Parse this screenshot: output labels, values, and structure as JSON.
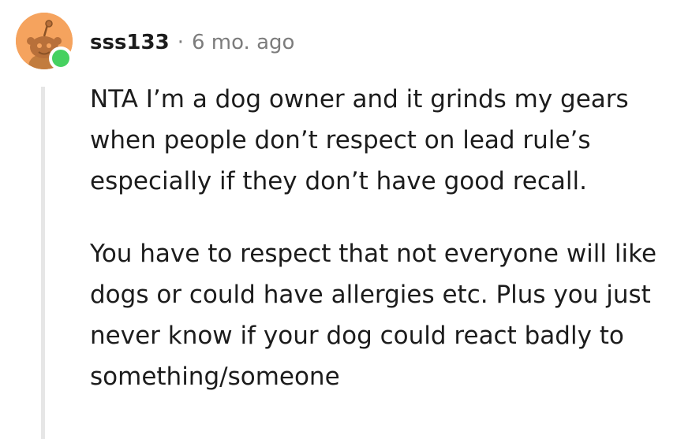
{
  "comment": {
    "author": "sss133",
    "separator": "·",
    "timestamp": "6 mo. ago",
    "avatar_icon": "reddit-snoo-avatar-icon",
    "online_status_color": "#46d160",
    "paragraphs": [
      "NTA I’m a dog owner and it grinds my gears when people don’t respect on lead rule’s especially if they don’t have good recall.",
      "You have to respect that not everyone will like dogs or could have allergies etc. Plus you just never know if your dog could react badly to something/someone"
    ]
  },
  "colors": {
    "avatar_background": "#f5a35e",
    "meta_text": "#7c7c7c",
    "thread_line": "#e6e6e6",
    "body_text": "#1c1c1c"
  }
}
